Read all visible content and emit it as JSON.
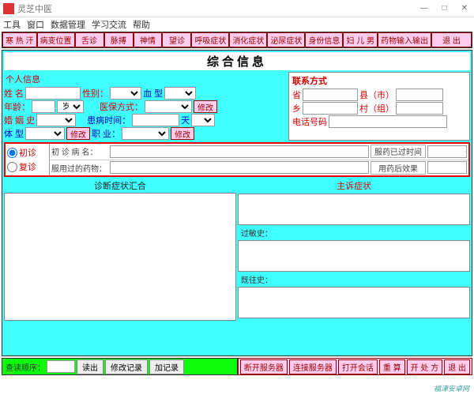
{
  "window": {
    "title": "灵芝中医"
  },
  "window_controls": {
    "min": "—",
    "max": "□",
    "close": "✕"
  },
  "menu": [
    "工具",
    "窗口",
    "数据管理",
    "学习交流",
    "帮助"
  ],
  "tabs": [
    "寒 热 汗",
    "病变位置",
    "舌诊",
    "脉搏",
    "神情",
    "望诊",
    "呼吸症状",
    "消化症状",
    "泌尿症状",
    "身份信息",
    "妇 儿 男",
    "药物输入输出",
    "退  出"
  ],
  "main_title": "综合信息",
  "personal": {
    "section": "个人信息",
    "name": "姓 名",
    "gender": "性别：",
    "blood": "血 型",
    "age": "年龄：",
    "age_unit": "岁",
    "insurance": "医保方式：",
    "modify": "修改",
    "marriage": "婚 姻 史",
    "illness_time": "患病时间：",
    "day": "天",
    "body": "体 型",
    "occupation": "职 业："
  },
  "contact": {
    "title": "联系方式",
    "province": "省",
    "county": "县（市）",
    "township": "乡",
    "village": "村（组）",
    "phone": "电话号码"
  },
  "visit": {
    "first": "初诊",
    "return": "复诊",
    "first_name": "初 诊 病 名：",
    "med_time": "服药已过时间",
    "used_med": "服用过的药物：",
    "med_effect": "用药后效果"
  },
  "diagnosis": {
    "summary": "诊断症状汇合",
    "complaint": "主诉症状",
    "allergy": "过敏史：",
    "history": "既往史："
  },
  "bottom_left": {
    "order": "查读顺序：",
    "read": "读出",
    "modify_rec": "修改记录",
    "add_rec": "加记录"
  },
  "bottom_right": [
    "断开服务器",
    "连接服务器",
    "打开会话",
    "重 算",
    "开 处 方",
    "退  出"
  ],
  "watermark": "福津安卓网"
}
